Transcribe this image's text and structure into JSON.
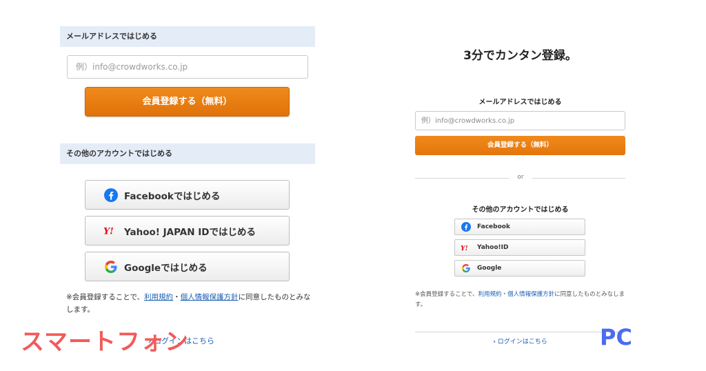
{
  "colors": {
    "accent_orange": "#e97f14",
    "link_blue": "#1a5fb4",
    "facebook_blue": "#1877f2",
    "yahoo_red": "#e60012",
    "band_blue": "#e4ecf7",
    "overlay_red": "#f25a5a",
    "overlay_blue": "#4b6cf0"
  },
  "smartphone": {
    "email_section_label": "メールアドレスではじめる",
    "email_placeholder": "例）info@crowdworks.co.jp",
    "register_button": "会員登録する（無料）",
    "other_section_label": "その他のアカウントではじめる",
    "social": {
      "facebook": "Facebookではじめる",
      "yahoo": "Yahoo! JAPAN IDではじめる",
      "google": "Googleではじめる"
    },
    "notice": {
      "prefix": "※会員登録することで、",
      "terms_link": "利用規約",
      "separator": "・",
      "privacy_link": "個人情報保護方針",
      "suffix": "に同意したものとみなします。"
    },
    "login_link": "ログインはこちら",
    "overlay_label": "スマートフォン"
  },
  "pc": {
    "headline": "3分でカンタン登録。",
    "email_section_label": "メールアドレスではじめる",
    "email_placeholder": "例）info@crowdworks.co.jp",
    "register_button": "会員登録する（無料）",
    "or_text": "or",
    "other_section_label": "その他のアカウントではじめる",
    "social": {
      "facebook": "Facebook",
      "yahoo": "Yahoo!ID",
      "google": "Google"
    },
    "notice": {
      "prefix": "※会員登録することで、",
      "terms_link": "利用規約",
      "separator": "・",
      "privacy_link": "個人情報保護方針",
      "suffix": "に同意したものとみなします。"
    },
    "login_link": "ログインはこちら",
    "overlay_label": "PC"
  },
  "icons": {
    "facebook": "facebook-icon",
    "yahoo": "yahoo-japan-icon",
    "google": "google-icon",
    "chevron": "chevron-right-icon"
  }
}
